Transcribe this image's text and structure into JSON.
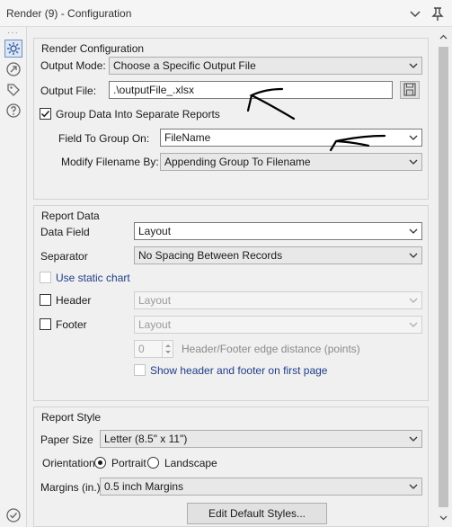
{
  "window": {
    "title": "Render (9) - Configuration"
  },
  "render_config": {
    "section_title": "Render Configuration",
    "output_mode_label": "Output Mode:",
    "output_mode_value": "Choose a Specific Output File",
    "output_file_label": "Output File:",
    "output_file_value": ".\\outputFile_.xlsx",
    "group_checkbox_label": "Group Data Into Separate Reports",
    "group_checked": true,
    "field_to_group_label": "Field To Group On:",
    "field_to_group_value": "FileName",
    "modify_filename_label": "Modify Filename By:",
    "modify_filename_value": "Appending Group To Filename"
  },
  "report_data": {
    "section_title": "Report Data",
    "data_field_label": "Data Field",
    "data_field_value": "Layout",
    "separator_label": "Separator",
    "separator_value": "No Spacing Between Records",
    "static_chart_label": "Use static chart",
    "header_label": "Header",
    "header_value": "Layout",
    "footer_label": "Footer",
    "footer_value": "Layout",
    "edge_distance_value": "0",
    "edge_distance_label": "Header/Footer edge distance (points)",
    "show_first_page_label": "Show header and footer on first page"
  },
  "report_style": {
    "section_title": "Report Style",
    "paper_size_label": "Paper Size",
    "paper_size_value": "Letter (8.5\" x 11\")",
    "orientation_label": "Orientation",
    "portrait_label": "Portrait",
    "landscape_label": "Landscape",
    "selected_orientation": "Portrait",
    "margins_label": "Margins (in.)",
    "margins_value": "0.5 inch Margins",
    "edit_styles_label": "Edit Default Styles..."
  },
  "colors": {
    "active_rail": "#6b8fc7",
    "link_text": "#1f3c88",
    "annotation_ink": "#000000"
  }
}
